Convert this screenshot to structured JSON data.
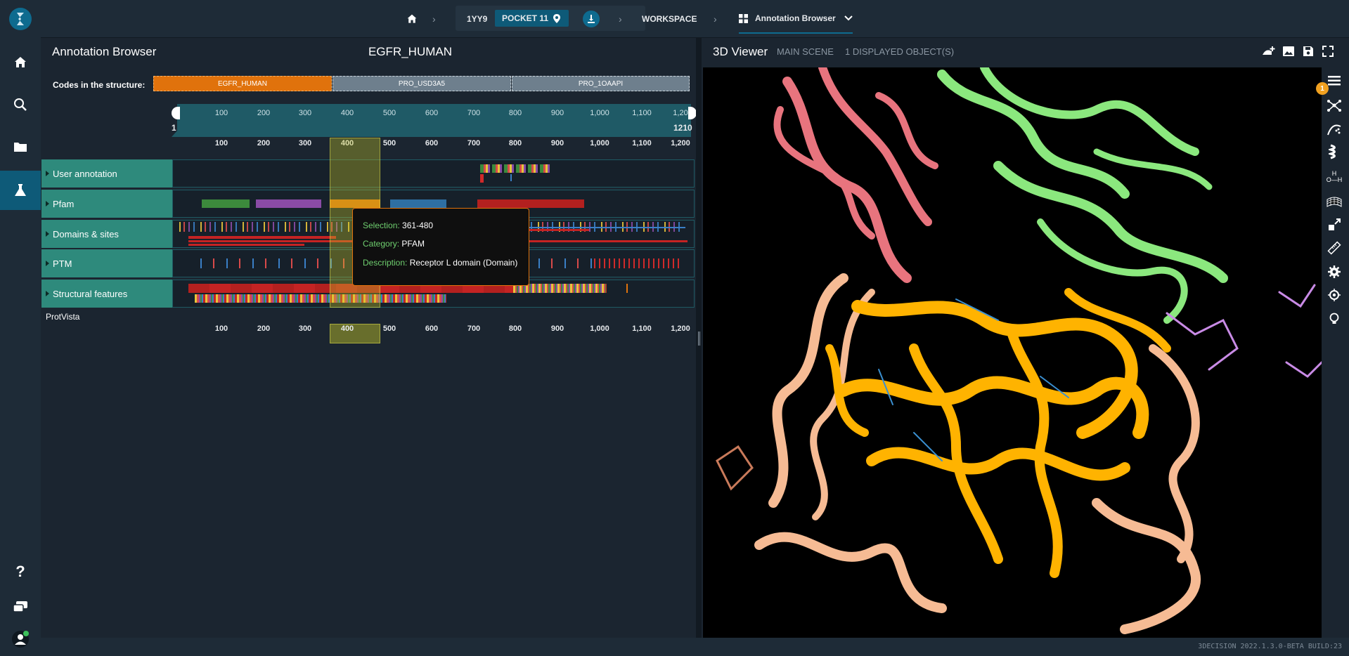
{
  "nav": {
    "items": [
      "home-icon",
      "search-icon",
      "folder-icon",
      "flask-icon"
    ],
    "bottom": [
      "help-icon",
      "chat-icon",
      "user-icon"
    ]
  },
  "topbar": {
    "structure_code": "1YY9",
    "pocket_label": "POCKET 11",
    "workspace_label": "WORKSPACE",
    "view_label": "Annotation Browser"
  },
  "annotation": {
    "title": "Annotation Browser",
    "protein": "EGFR_HUMAN",
    "codes_label": "Codes in the structure:",
    "codes": [
      "EGFR_HUMAN",
      "PRO_USD3A5",
      "PRO_1OAAPI"
    ],
    "range_start": "1",
    "range_end": "1210",
    "ticks": [
      "100",
      "200",
      "300",
      "400",
      "500",
      "600",
      "700",
      "800",
      "900",
      "1,000",
      "1,100",
      "1,20"
    ],
    "ticks_main": [
      "100",
      "200",
      "300",
      "400",
      "500",
      "600",
      "700",
      "800",
      "900",
      "1,000",
      "1,100",
      "1,200"
    ],
    "tracks": [
      "User annotation",
      "Pfam",
      "Domains & sites",
      "PTM",
      "Structural features"
    ],
    "footer_label": "ProtVista",
    "tooltip": {
      "selection_label": "Selection:",
      "selection_value": "361-480",
      "category_label": "Category:",
      "category_value": "PFAM",
      "description_label": "Description:",
      "description_value": "Receptor L domain (Domain)"
    }
  },
  "viewer": {
    "title": "3D Viewer",
    "scene": "MAIN SCENE",
    "objects": "1 DISPLAYED OBJECT(S)",
    "badge": "1"
  },
  "footer": {
    "version": "3DECISION 2022.1.3.0-BETA BUILD:23"
  },
  "colors": {
    "accent": "#0e5a78",
    "track_label": "#2e8a7c",
    "egfr_code": "#e0720c",
    "other_code": "#6e7f8d"
  }
}
